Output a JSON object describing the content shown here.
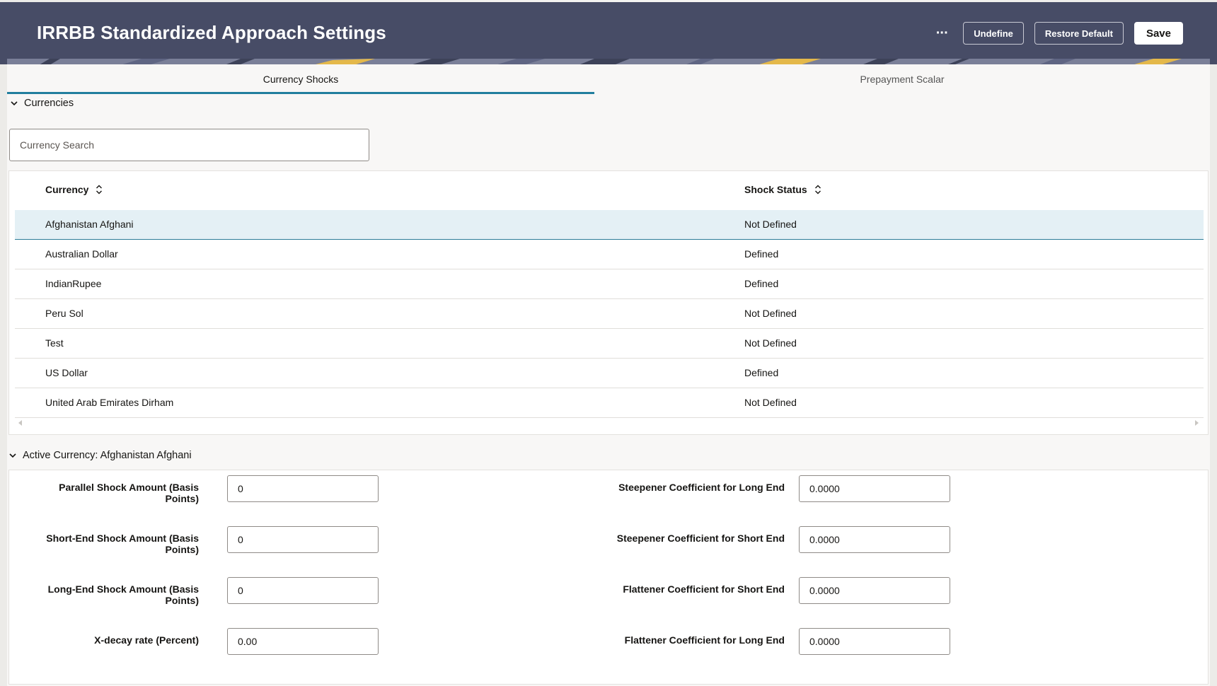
{
  "header": {
    "title": "IRRBB Standardized Approach Settings",
    "more_label": "···",
    "undefine_label": "Undefine",
    "restore_label": "Restore Default",
    "save_label": "Save",
    "background_color": "#474c66"
  },
  "tabs": [
    {
      "label": "Currency Shocks",
      "active": true
    },
    {
      "label": "Prepayment Scalar",
      "active": false
    }
  ],
  "currencies_section": {
    "title": "Currencies",
    "search_placeholder": "Currency Search",
    "columns": [
      "Currency",
      "Shock Status"
    ],
    "rows": [
      {
        "currency": "Afghanistan Afghani",
        "status": "Not Defined",
        "selected": true
      },
      {
        "currency": "Australian Dollar",
        "status": "Defined"
      },
      {
        "currency": "IndianRupee",
        "status": "Defined"
      },
      {
        "currency": "Peru Sol",
        "status": "Not Defined"
      },
      {
        "currency": "Test",
        "status": "Not Defined"
      },
      {
        "currency": "US Dollar",
        "status": "Defined"
      },
      {
        "currency": "United Arab Emirates Dirham",
        "status": "Not Defined"
      }
    ]
  },
  "active_section": {
    "title": "Active Currency: Afghanistan Afghani",
    "left_fields": [
      {
        "label": "Parallel Shock Amount (Basis Points)",
        "value": "0"
      },
      {
        "label": "Short-End Shock Amount (Basis Points)",
        "value": "0"
      },
      {
        "label": "Long-End Shock Amount (Basis Points)",
        "value": "0"
      },
      {
        "label": "X-decay rate (Percent)",
        "value": "0.00"
      }
    ],
    "right_fields": [
      {
        "label": "Steepener Coefficient for Long End",
        "value": "0.0000"
      },
      {
        "label": "Steepener Coefficient for Short End",
        "value": "0.0000"
      },
      {
        "label": "Flattener Coefficient for Short End",
        "value": "0.0000"
      },
      {
        "label": "Flattener Coefficient for Long End",
        "value": "0.0000"
      }
    ]
  },
  "colors": {
    "accent": "#227e9e",
    "selected_row": "#e4f0f5"
  }
}
